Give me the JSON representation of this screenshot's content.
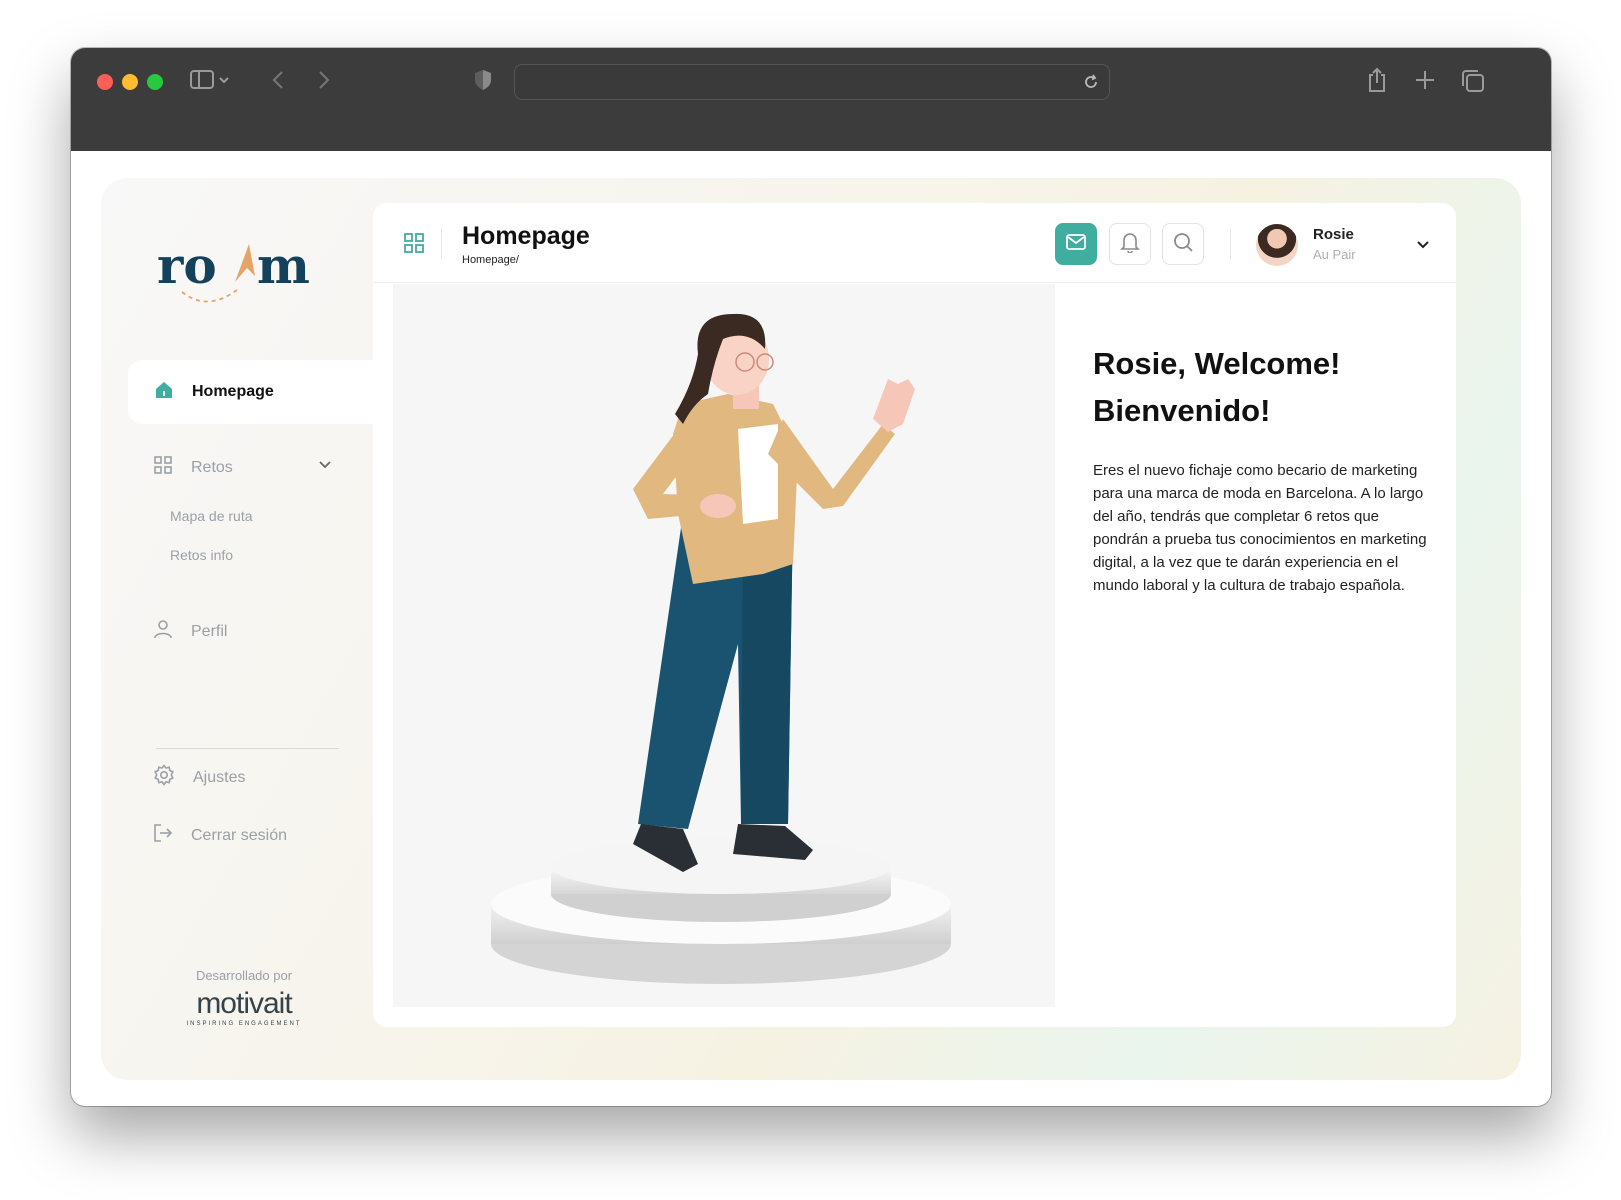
{
  "sidebar": {
    "logo_text": "roam",
    "items": [
      {
        "label": "Homepage",
        "icon": "home-icon"
      },
      {
        "label": "Retos",
        "icon": "grid-icon"
      },
      {
        "label": "Perfil",
        "icon": "user-icon"
      },
      {
        "label": "Ajustes",
        "icon": "gear-icon"
      },
      {
        "label": "Cerrar sesión",
        "icon": "logout-icon"
      }
    ],
    "sub_items": [
      "Mapa de ruta",
      "Retos info"
    ],
    "credit_label": "Desarrollado por",
    "credit_brand": "motivait",
    "credit_tagline": "INSPIRING ENGAGEMENT"
  },
  "header": {
    "title": "Homepage",
    "breadcrumb": "Homepage/",
    "user": {
      "name": "Rosie",
      "role": "Au Pair"
    }
  },
  "welcome": {
    "title_line1": "Rosie, Welcome!",
    "title_line2": "Bienvenido!",
    "body": "Eres el nuevo fichaje como becario de marketing para una marca de moda en Barcelona. A lo largo del año, tendrás que completar 6 retos que pondrán a prueba tus conocimientos en marketing digital, a la vez que te darán experiencia en el mundo laboral y la cultura de trabajo española."
  },
  "colors": {
    "accent": "#3fada0",
    "brand_navy": "#14425c",
    "brand_orange": "#e3a56a"
  }
}
